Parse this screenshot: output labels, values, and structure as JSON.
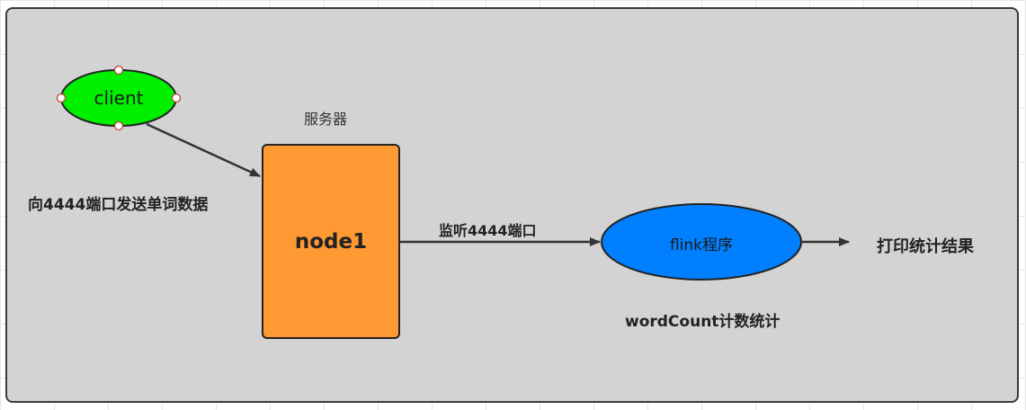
{
  "nodes": {
    "client": {
      "label": "client",
      "fill": "#00f000"
    },
    "server": {
      "label": "node1",
      "fill": "#ff9933",
      "caption": "服务器"
    },
    "flink": {
      "label": "flink程序",
      "fill": "#0080ff",
      "caption": "wordCount计数统计"
    }
  },
  "edges": {
    "send": {
      "label": "向4444端口发送单词数据"
    },
    "listen": {
      "label": "监听4444端口"
    },
    "print": {
      "label": "打印统计结果"
    }
  },
  "colors": {
    "canvas": "#d3d3d3",
    "stroke": "#3a3a3a"
  }
}
